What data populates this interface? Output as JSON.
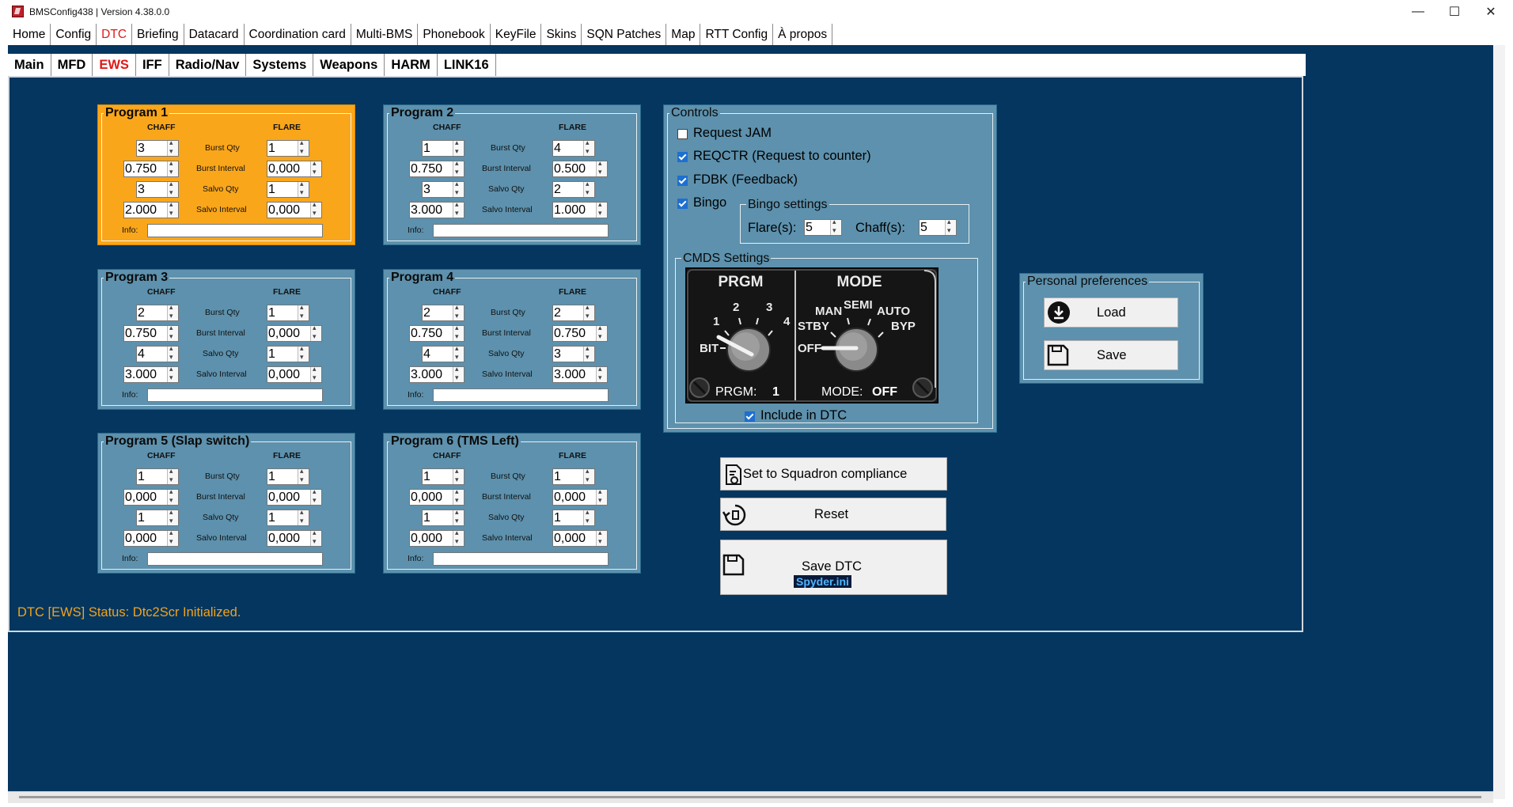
{
  "window": {
    "title": "BMSConfig438 | Version 4.38.0.0",
    "controls": [
      "—",
      "☐",
      "✕"
    ]
  },
  "menu": [
    {
      "label": "Home"
    },
    {
      "label": "Config"
    },
    {
      "label": "DTC",
      "active": true
    },
    {
      "label": "Briefing"
    },
    {
      "label": "Datacard"
    },
    {
      "label": "Coordination card"
    },
    {
      "label": "Multi-BMS"
    },
    {
      "label": "Phonebook"
    },
    {
      "label": "KeyFile"
    },
    {
      "label": "Skins"
    },
    {
      "label": "SQN Patches"
    },
    {
      "label": "Map"
    },
    {
      "label": "RTT Config"
    },
    {
      "label": "À propos"
    }
  ],
  "subtabs": [
    {
      "label": "Main"
    },
    {
      "label": "MFD"
    },
    {
      "label": "EWS",
      "active": true
    },
    {
      "label": "IFF"
    },
    {
      "label": "Radio/Nav"
    },
    {
      "label": "Systems"
    },
    {
      "label": "Weapons"
    },
    {
      "label": "HARM"
    },
    {
      "label": "LINK16"
    }
  ],
  "program_common": {
    "chaff_label": "CHAFF",
    "flare_label": "FLARE",
    "rows": [
      "Burst Qty",
      "Burst Interval",
      "Salvo Qty",
      "Salvo Interval"
    ],
    "info_label": "Info:"
  },
  "programs": [
    {
      "title": "Program 1",
      "active": true,
      "chaff": [
        "3",
        "0.750",
        "3",
        "2.000"
      ],
      "flare": [
        "1",
        "0,000",
        "1",
        "0,000"
      ]
    },
    {
      "title": "Program 2",
      "chaff": [
        "1",
        "0.750",
        "3",
        "3.000"
      ],
      "flare": [
        "4",
        "0.500",
        "2",
        "1.000"
      ]
    },
    {
      "title": "Program 3",
      "chaff": [
        "2",
        "0.750",
        "4",
        "3.000"
      ],
      "flare": [
        "1",
        "0,000",
        "1",
        "0,000"
      ]
    },
    {
      "title": "Program 4",
      "chaff": [
        "2",
        "0.750",
        "4",
        "3.000"
      ],
      "flare": [
        "2",
        "0.750",
        "3",
        "3.000"
      ]
    },
    {
      "title": "Program 5 (Slap switch)",
      "chaff": [
        "1",
        "0,000",
        "1",
        "0,000"
      ],
      "flare": [
        "1",
        "0,000",
        "1",
        "0,000"
      ]
    },
    {
      "title": "Program 6 (TMS Left)",
      "chaff": [
        "1",
        "0,000",
        "1",
        "0,000"
      ],
      "flare": [
        "1",
        "0,000",
        "1",
        "0,000"
      ]
    }
  ],
  "controls": {
    "title": "Controls",
    "request_jam": {
      "label": "Request JAM",
      "checked": false
    },
    "reqctr": {
      "label": "REQCTR (Request to counter)",
      "checked": true
    },
    "fdbk": {
      "label": "FDBK (Feedback)",
      "checked": true
    },
    "bingo": {
      "label": "Bingo",
      "checked": true
    },
    "bingo_settings": {
      "title": "Bingo settings",
      "flare_label": "Flare(s):",
      "flare_value": "5",
      "chaff_label": "Chaff(s):",
      "chaff_value": "5"
    },
    "cmds": {
      "title": "CMDS Settings",
      "prgm_title": "PRGM",
      "prgm_marks": [
        "BIT",
        "1",
        "2",
        "3",
        "4"
      ],
      "prgm_readout_label": "PRGM:",
      "prgm_readout_value": "1",
      "mode_title": "MODE",
      "mode_marks": [
        "OFF",
        "STBY",
        "MAN",
        "SEMI",
        "AUTO",
        "BYP"
      ],
      "mode_readout_label": "MODE:",
      "mode_readout_value": "OFF",
      "include_label": "Include in DTC",
      "include_checked": true
    }
  },
  "actions": {
    "squadron": "Set to Squadron compliance",
    "reset": "Reset",
    "save_dtc": "Save DTC",
    "save_dtc_file": "Spyder.ini"
  },
  "prefs": {
    "title": "Personal preferences",
    "load": "Load",
    "save": "Save"
  },
  "status": "DTC [EWS] Status: Dtc2Scr Initialized.",
  "colors": {
    "workspace": "#04365f",
    "panel": "#5d91ad",
    "active_program": "#faa61a",
    "active_tab": "#e01818",
    "status_text": "#f3a21c"
  }
}
